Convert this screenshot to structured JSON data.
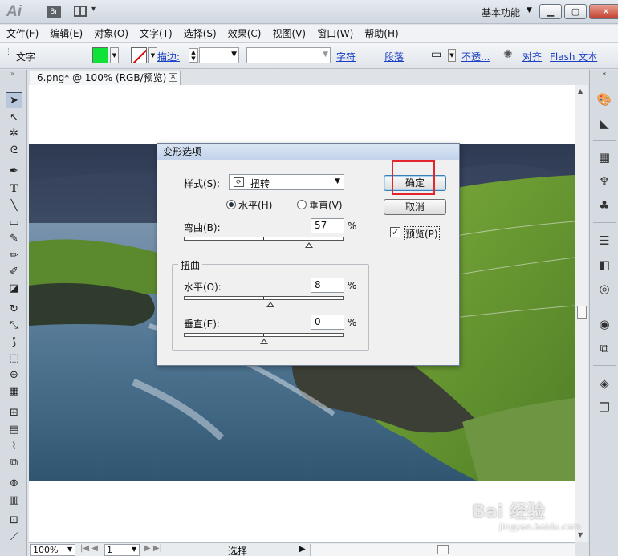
{
  "titlebar": {
    "app_logo": "Ai",
    "bridge_badge": "Br",
    "workspace": "基本功能"
  },
  "menu": [
    "文件(F)",
    "编辑(E)",
    "对象(O)",
    "文字(T)",
    "选择(S)",
    "效果(C)",
    "视图(V)",
    "窗口(W)",
    "帮助(H)"
  ],
  "controlbar": {
    "tool_name": "文字",
    "stroke_label": "描边:",
    "character_link": "字符",
    "paragraph_link": "段落",
    "opacity_link": "不透...",
    "align_link": "对齐",
    "flash_text_link": "Flash 文本",
    "fill_color": "#0fe33a"
  },
  "document": {
    "tab_title": "6.png* @ 100% (RGB/预览)"
  },
  "statusbar": {
    "zoom": "100%",
    "artboard": "1",
    "mode": "选择"
  },
  "dialog": {
    "title": "变形选项",
    "style_label": "样式(S):",
    "style_value": "扭转",
    "horizontal_radio": "水平(H)",
    "vertical_radio": "垂直(V)",
    "orientation_value": 0,
    "bend_label": "弯曲(B):",
    "bend_value": "57",
    "percent": "%",
    "distortion_group": "扭曲",
    "dist_h_label": "水平(O):",
    "dist_h_value": "8",
    "dist_v_label": "垂直(E):",
    "dist_v_value": "0",
    "ok_button": "确定",
    "cancel_button": "取消",
    "preview_label": "预览(P)",
    "preview_checked": "✓"
  },
  "watermark": {
    "brand": "Bai 经验",
    "url": "jingyan.baidu.com"
  }
}
